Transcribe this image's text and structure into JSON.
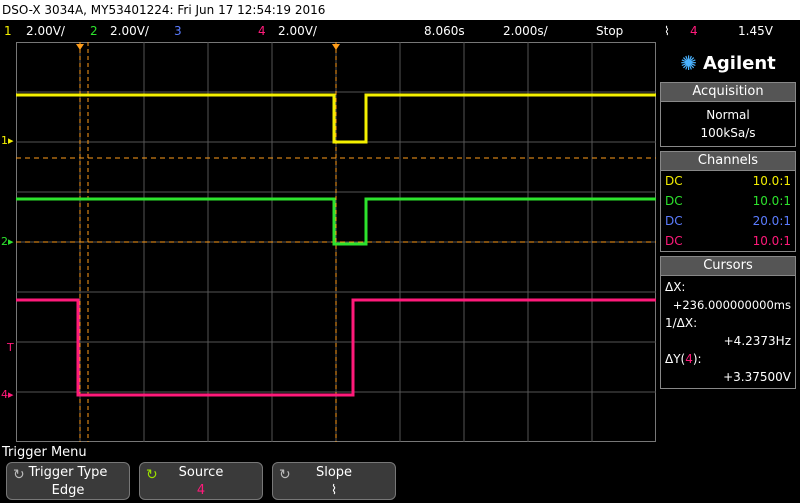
{
  "title": "DSO-X 3034A, MY53401224: Fri Jun 17 12:54:19 2016",
  "status": {
    "ch1_num": "1",
    "ch1_scale": "2.00V/",
    "ch2_num": "2",
    "ch2_scale": "2.00V/",
    "ch3_num": "3",
    "ch4_num": "4",
    "ch4_scale": "2.00V/",
    "time_delay": "8.060s",
    "time_scale": "2.000s/",
    "run_state": "Stop",
    "trigger_source": "4",
    "trigger_level": "1.45V"
  },
  "colors": {
    "ch1": "#f4f000",
    "ch2": "#2de32d",
    "ch3": "#5b7cff",
    "ch4": "#ff1a7a",
    "orange": "#ff9d1a"
  },
  "brand": "Agilent",
  "acquisition": {
    "header": "Acquisition",
    "mode": "Normal",
    "rate": "100kSa/s"
  },
  "channels": {
    "header": "Channels",
    "rows": [
      {
        "coupling": "DC",
        "probe": "10.0:1"
      },
      {
        "coupling": "DC",
        "probe": "10.0:1"
      },
      {
        "coupling": "DC",
        "probe": "20.0:1"
      },
      {
        "coupling": "DC",
        "probe": "10.0:1"
      }
    ]
  },
  "cursors": {
    "header": "Cursors",
    "dx_label": "ΔX:",
    "dx_value": "+236.000000000ms",
    "inv_label": "1/ΔX:",
    "inv_value": "+4.2373Hz",
    "dy_label_pre": "ΔY(",
    "dy_label_ch": "4",
    "dy_label_post": "):",
    "dy_value": "+3.37500V"
  },
  "markers": {
    "ch1": "1",
    "ch2": "2",
    "ch4": "4",
    "trig": "T"
  },
  "menu": {
    "title": "Trigger Menu",
    "softkeys": [
      {
        "label": "Trigger Type",
        "value": "Edge"
      },
      {
        "label": "Source",
        "value": "4"
      },
      {
        "label": "Slope",
        "value": "⌇"
      }
    ]
  }
}
